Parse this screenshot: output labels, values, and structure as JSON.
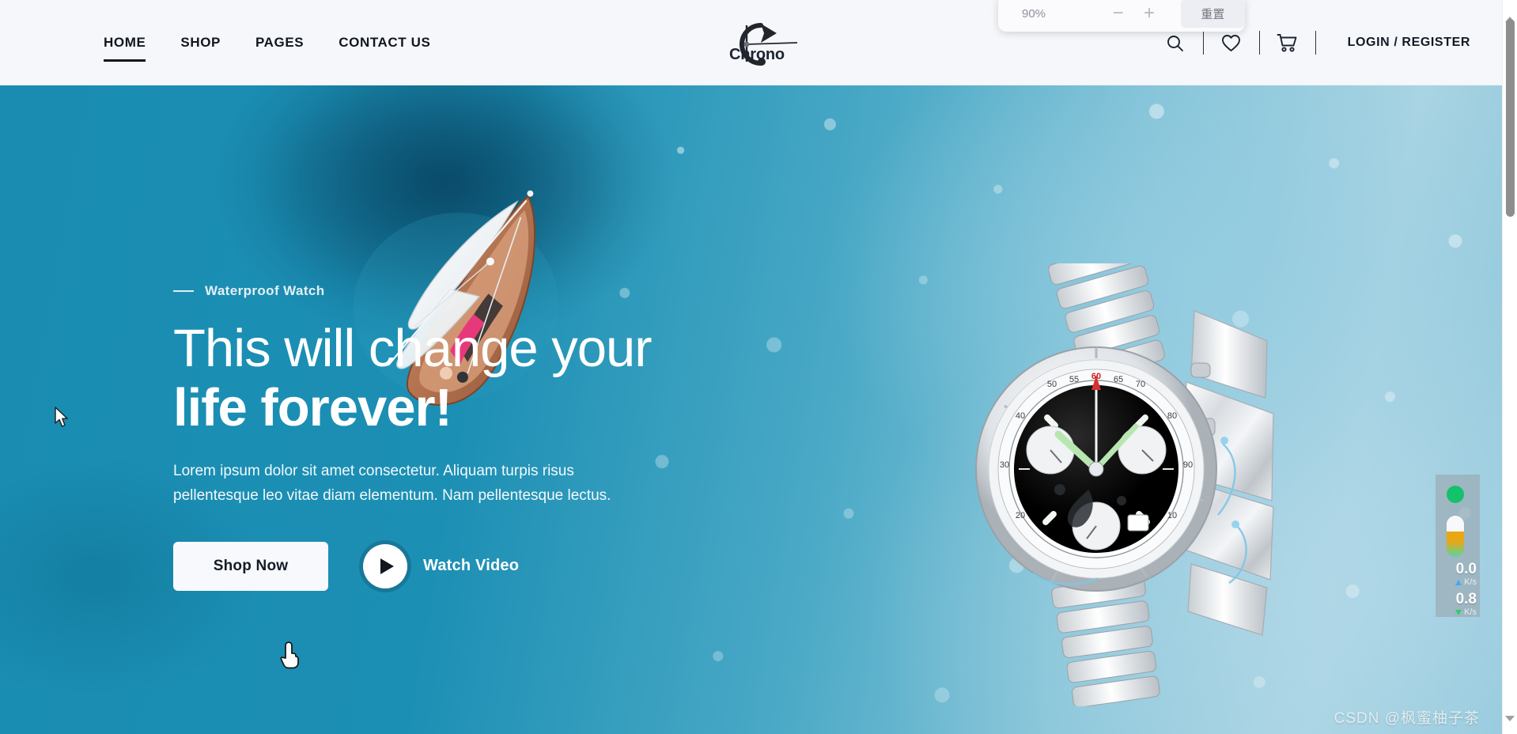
{
  "header": {
    "nav": [
      {
        "label": "HOME",
        "active": true
      },
      {
        "label": "SHOP",
        "active": false
      },
      {
        "label": "PAGES",
        "active": false
      },
      {
        "label": "CONTACT US",
        "active": false
      }
    ],
    "logo_text": "Chrono",
    "icons": [
      "search-icon",
      "heart-icon",
      "cart-icon"
    ],
    "login_label": "LOGIN / REGISTER",
    "background_color": "#f5f7fb"
  },
  "zoom_popup": {
    "level": "90%",
    "minus_label": "−",
    "plus_label": "+",
    "reset_label": "重置"
  },
  "hero": {
    "eyebrow": "Waterproof Watch",
    "title_line1": "This will change your",
    "title_line2": "life forever!",
    "paragraph": "Lorem ipsum dolor sit amet consectetur. Aliquam turpis risus pellentesque leo vitae diam elementum. Nam pellentesque lectus.",
    "primary_button": "Shop Now",
    "video_label": "Watch Video",
    "background_color": "#1389b1",
    "text_color": "#ffffff",
    "images": [
      "sailboat-aerial-photo",
      "chronograph-wristwatch-in-water-splash"
    ]
  },
  "net_speed": {
    "upload_value": "0.0",
    "upload_unit": "K/s",
    "download_value": "0.8",
    "download_unit": "K/s"
  },
  "watermark": "CSDN @枫蜜柚子茶"
}
